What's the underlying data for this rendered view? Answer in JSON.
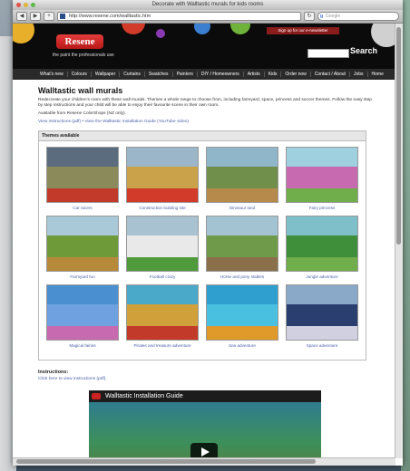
{
  "window": {
    "title": "Decorate with Walltastic murals for kids rooms"
  },
  "toolbar": {
    "url": "http://www.resene.com/walltastic.htm",
    "search_placeholder": "Google"
  },
  "header": {
    "logo": "Resene",
    "tagline": "the paint the professionals use",
    "signup": "Sign up for our e-newsletter",
    "search_label": "Search"
  },
  "nav": [
    "What's new",
    "Colours",
    "Wallpaper",
    "Curtains",
    "Swatches",
    "Painters",
    "DIY / Homeowners",
    "Artists",
    "Kids",
    "Order now",
    "Contact / About",
    "Jobs",
    "Home"
  ],
  "main": {
    "title": "Walltastic wall murals",
    "intro": "Redecorate your children's room with these wall murals. Themes a whole range to choose from, including farmyard, space, princess and soccer themes. Follow the easy step by step instructions and your child will be able to enjoy their favourite scene in their own room.",
    "availability": "Available from Resene ColorShops (NZ only).",
    "links_line": "View instructions (pdf) • View the Walltastic Installation Guide (YouTube video)",
    "themes_heading": "Themes available",
    "themes": [
      {
        "label": "Car racers",
        "colors": [
          "#5a6c7e",
          "#8a8a5a",
          "#c23b2a"
        ]
      },
      {
        "label": "Construction building site",
        "colors": [
          "#9ab6c8",
          "#c9a24a",
          "#d23a2a"
        ]
      },
      {
        "label": "Dinosaur land",
        "colors": [
          "#8fb6c9",
          "#6f8f4a",
          "#b58a4a"
        ]
      },
      {
        "label": "Fairy princess",
        "colors": [
          "#9fd0e0",
          "#c86ab0",
          "#6fae4a"
        ]
      },
      {
        "label": "Farmyard fun",
        "colors": [
          "#a9c8d8",
          "#6f9a3a",
          "#b7893a"
        ]
      },
      {
        "label": "Football crazy",
        "colors": [
          "#a9c2d2",
          "#e9e9e9",
          "#4f9a3a"
        ]
      },
      {
        "label": "Horse and pony stables",
        "colors": [
          "#a3c3d3",
          "#6f9a4a",
          "#8a6f4a"
        ]
      },
      {
        "label": "Jungle adventure",
        "colors": [
          "#7fbfc9",
          "#3f8f3a",
          "#6fae4a"
        ]
      },
      {
        "label": "Magical fairies",
        "colors": [
          "#4a8fd0",
          "#6fa0e0",
          "#c86ab0"
        ]
      },
      {
        "label": "Pirates and treasure adventure",
        "colors": [
          "#4aa8c9",
          "#d0a03a",
          "#c23b2a"
        ]
      },
      {
        "label": "Sea adventure",
        "colors": [
          "#2f9fd0",
          "#4ac0e0",
          "#e09a2a"
        ]
      },
      {
        "label": "Space adventure",
        "colors": [
          "#8aa8c8",
          "#2a3f6f",
          "#d0d0e0"
        ]
      }
    ],
    "instructions_title": "Instructions:",
    "instructions_link": "Click here to view instructions (pdf).",
    "video_title": "Walltastic Installation Guide"
  }
}
